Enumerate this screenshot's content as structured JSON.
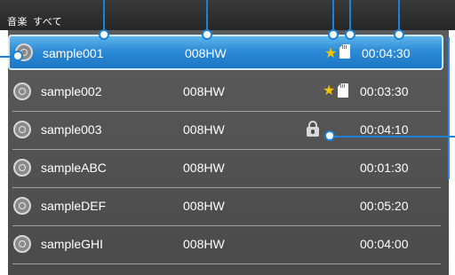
{
  "header": {
    "breadcrumb": [
      "音楽",
      "すべて"
    ]
  },
  "list": {
    "selected_index": 0,
    "rows": [
      {
        "name": "sample001",
        "album": "008HW",
        "duration": "00:04:30",
        "favorite": true,
        "memory_card": true,
        "locked": false
      },
      {
        "name": "sample002",
        "album": "008HW",
        "duration": "00:03:30",
        "favorite": true,
        "memory_card": true,
        "locked": false
      },
      {
        "name": "sample003",
        "album": "008HW",
        "duration": "00:04:10",
        "favorite": false,
        "memory_card": false,
        "locked": true
      },
      {
        "name": "sampleABC",
        "album": "008HW",
        "duration": "00:01:30",
        "favorite": false,
        "memory_card": false,
        "locked": false
      },
      {
        "name": "sampleDEF",
        "album": "008HW",
        "duration": "00:05:20",
        "favorite": false,
        "memory_card": false,
        "locked": false
      },
      {
        "name": "sampleGHI",
        "album": "008HW",
        "duration": "00:04:00",
        "favorite": false,
        "memory_card": false,
        "locked": false
      }
    ]
  },
  "icons": {
    "row_icon": "disc-icon",
    "favorite": "star-icon",
    "memory_card": "sd-card-icon",
    "locked": "lock-icon"
  },
  "colors": {
    "selection": "#2c8ad6",
    "star": "#f2c400",
    "callout": "#1b82d6",
    "list_background": "#545454",
    "header_background": "#2f2f2f"
  }
}
